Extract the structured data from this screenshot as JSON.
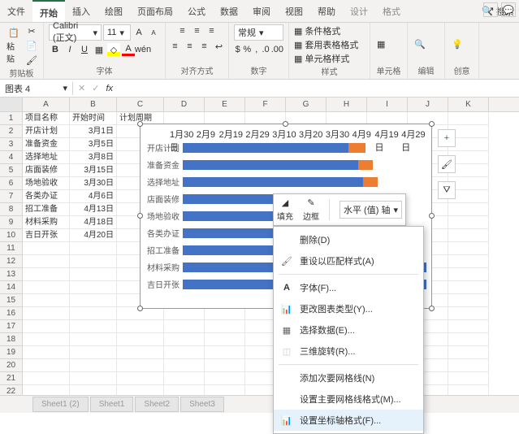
{
  "menu": {
    "tabs": [
      "文件",
      "开始",
      "插入",
      "绘图",
      "页面布局",
      "公式",
      "数据",
      "审阅",
      "视图",
      "帮助",
      "设计",
      "格式"
    ],
    "search": "搜索"
  },
  "ribbon": {
    "clipboard": {
      "label": "剪贴板",
      "paste": "粘贴"
    },
    "font": {
      "label": "字体",
      "name": "Calibri (正文)",
      "size": "11"
    },
    "align": {
      "label": "对齐方式"
    },
    "number": {
      "label": "数字",
      "format": "常规"
    },
    "styles": {
      "label": "样式",
      "cond": "条件格式",
      "table": "套用表格格式",
      "cell": "单元格样式"
    },
    "cells": {
      "label": "单元格"
    },
    "editing": {
      "label": "编辑"
    },
    "ideas": {
      "label": "创意"
    }
  },
  "namebox": "图表 4",
  "fx": "fx",
  "cols": [
    "A",
    "B",
    "C",
    "D",
    "E",
    "F",
    "G",
    "H",
    "I",
    "J",
    "K"
  ],
  "header_row": {
    "a": "项目名称",
    "b": "开始时间",
    "c": "计划周期"
  },
  "rows": [
    {
      "a": "开店计划",
      "b": "3月1日"
    },
    {
      "a": "准备资金",
      "b": "3月5日"
    },
    {
      "a": "选择地址",
      "b": "3月8日"
    },
    {
      "a": "店面装修",
      "b": "3月15日"
    },
    {
      "a": "场地验收",
      "b": "3月30日"
    },
    {
      "a": "各类办证",
      "b": "4月6日"
    },
    {
      "a": "招工准备",
      "b": "4月13日"
    },
    {
      "a": "材料采购",
      "b": "4月18日"
    },
    {
      "a": "吉日开张",
      "b": "4月20日"
    }
  ],
  "chart_data": {
    "type": "bar",
    "orientation": "horizontal",
    "x_ticks": [
      "1月30日",
      "2月9日",
      "2月19日",
      "2月29日",
      "3月10日",
      "3月20日",
      "3月30日",
      "4月9日",
      "4月19日",
      "4月29日"
    ],
    "categories": [
      "开店计划",
      "准备资金",
      "选择地址",
      "店面装修",
      "场地验收",
      "各类办证",
      "招工准备",
      "材料采购",
      "吉日开张"
    ],
    "series": [
      {
        "name": "开始时间",
        "color": "#4472c4",
        "values_pct": [
          68,
          72,
          74,
          80,
          90,
          94,
          98,
          100,
          100
        ]
      },
      {
        "name": "计划周期",
        "color": "#ed7d31",
        "values_pct": [
          7,
          6,
          6,
          0,
          0,
          0,
          0,
          0,
          0
        ]
      }
    ]
  },
  "fill_popup": {
    "fill": "填充",
    "border": "边框",
    "axis_select": "水平 (值) 轴"
  },
  "ctx": {
    "delete": "删除(D)",
    "reset": "重设以匹配样式(A)",
    "font": "字体(F)...",
    "change": "更改图表类型(Y)...",
    "select": "选择数据(E)...",
    "rotate3d": "三维旋转(R)...",
    "minor": "添加次要网格线(N)",
    "major": "设置主要网格线格式(M)...",
    "axisfmt": "设置坐标轴格式(F)..."
  },
  "sheet_tabs": [
    "Sheet1 (2)",
    "Sheet1",
    "Sheet2",
    "Sheet3"
  ]
}
